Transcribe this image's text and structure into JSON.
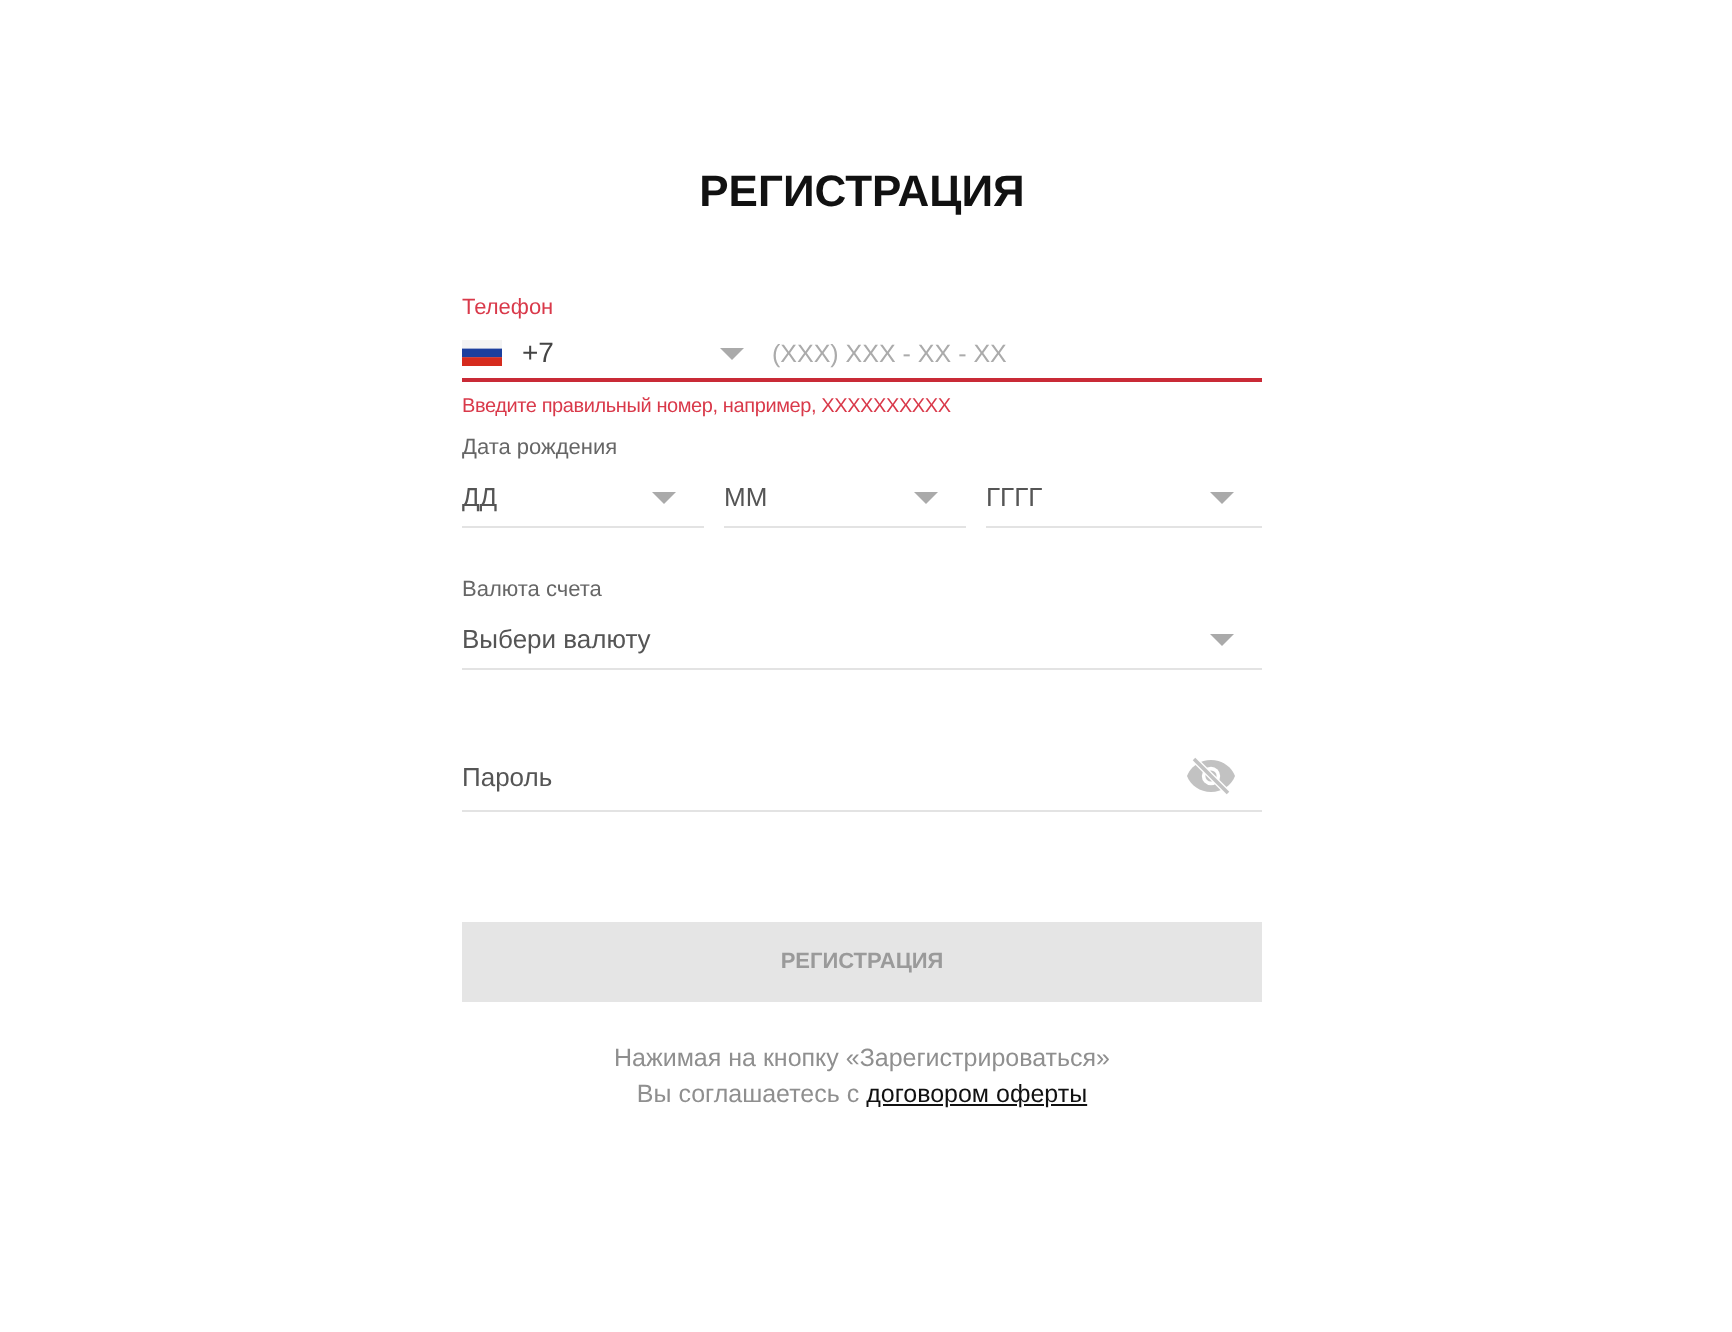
{
  "title": "РЕГИСТРАЦИЯ",
  "phone": {
    "label": "Телефон",
    "country_code": "+7",
    "placeholder": "(XXX) XXX - XX - XX",
    "invalid": true,
    "error": "Введите правильный номер, например, XXXXXXXXXX"
  },
  "birth_date": {
    "label": "Дата рождения",
    "fields": [
      {
        "placeholder": "ДД"
      },
      {
        "placeholder": "ММ"
      },
      {
        "placeholder": "ГГГГ"
      }
    ]
  },
  "currency": {
    "label": "Валюта счета",
    "placeholder": "Выбери валюту"
  },
  "password": {
    "placeholder": "Пароль",
    "visible": false
  },
  "submit_button": {
    "label": "РЕГИСТРАЦИЯ",
    "disabled": true
  },
  "terms": {
    "line_1": "Нажимая на кнопку «Зарегистрироваться»",
    "line_2": "Вы соглашаетесь с",
    "link": "договором оферты"
  }
}
